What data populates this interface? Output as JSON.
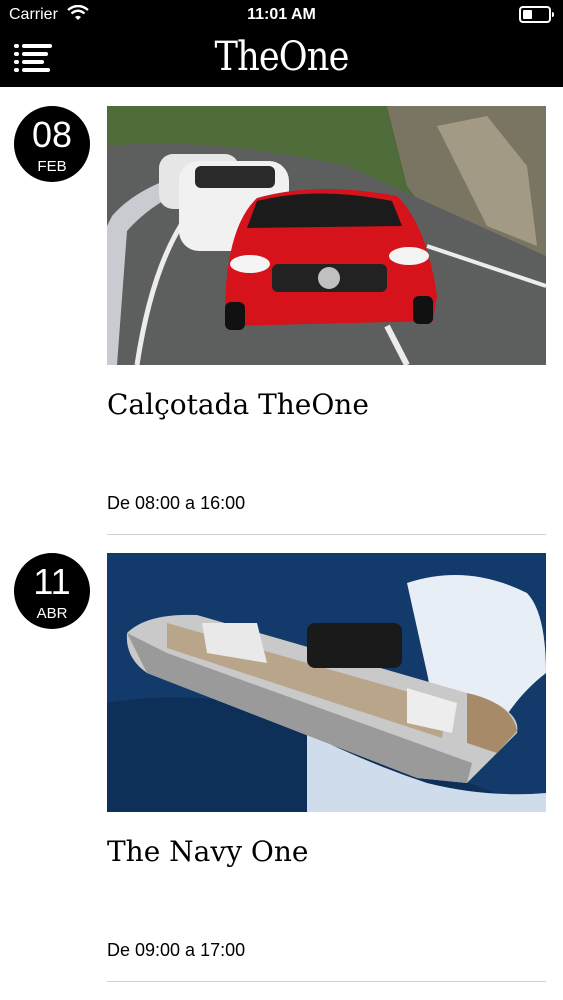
{
  "status_bar": {
    "carrier": "Carrier",
    "time": "11:01 AM"
  },
  "header": {
    "brand": "TheOne",
    "menu_icon": "menu-icon"
  },
  "events": [
    {
      "day": "08",
      "month": "FEB",
      "title": "Calçotada TheOne",
      "schedule": "De 08:00 a 16:00",
      "photo": "red-sports-cars-on-road"
    },
    {
      "day": "11",
      "month": "ABR",
      "title": "The Navy One",
      "schedule": "De 09:00 a 17:00",
      "photo": "speedboat-on-sea"
    }
  ],
  "colors": {
    "header_bg": "#000000",
    "page_bg": "#ffffff",
    "divider": "#d0d0d0"
  }
}
